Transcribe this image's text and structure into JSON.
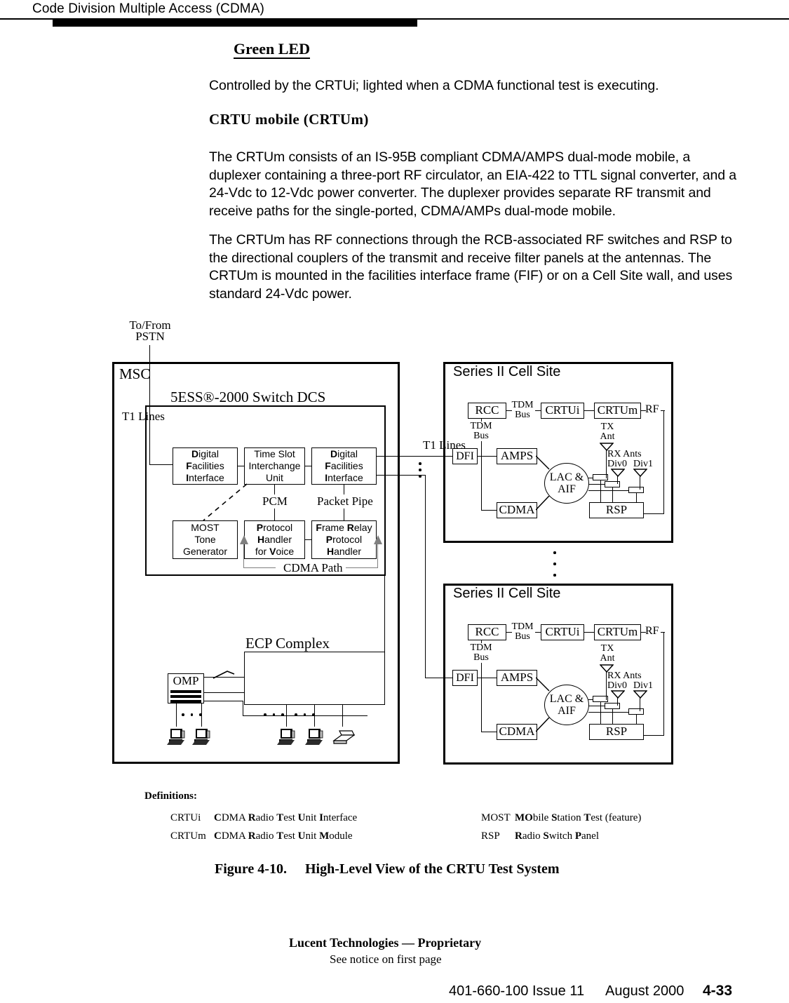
{
  "header": {
    "running_head": "Code Division Multiple Access (CDMA)"
  },
  "body": {
    "green_led_heading": "Green LED",
    "green_led_text": "Controlled by the CRTUi; lighted when a CDMA functional test is executing.",
    "crtum_heading": "CRTU mobile (CRTUm)",
    "paragraph_1": "The CRTUm consists of an IS-95B compliant CDMA/AMPS dual-mode mobile, a duplexer containing a three-port RF circulator, an EIA-422 to TTL signal converter, and a 24-Vdc to 12-Vdc power converter. The duplexer provides separate RF transmit and receive paths for the single-ported, CDMA/AMPs dual-mode mobile.",
    "paragraph_2": "The CRTUm has RF connections through the RCB-associated RF switches and RSP to the directional couplers of the transmit and receive filter panels at the antennas. The CRTUm is mounted in the facilities interface frame (FIF) or on a Cell Site wall, and uses standard 24-Vdc power."
  },
  "figure": {
    "pstn_label": "To/From\nPSTN",
    "pstn_line1": "To/From",
    "pstn_line2": "PSTN",
    "msc_label": "MSC",
    "switch_title": "5ESS®-2000 Switch DCS",
    "t1_lines_left": "T1 Lines",
    "t1_lines_right": "T1 Lines",
    "ecp_label": "ECP Complex",
    "omp_label": "OMP",
    "switch_boxes": {
      "dfi_left": [
        "Digital",
        "Facilities",
        "Interface"
      ],
      "tsiu": [
        "Time Slot",
        "Interchange",
        "Unit"
      ],
      "dfi_right": [
        "Digital",
        "Facilities",
        "Interface"
      ],
      "most": [
        "MOST",
        "Tone",
        "Generator"
      ],
      "phv": [
        "Protocol",
        "Handler",
        "for Voice"
      ],
      "frph": [
        "Frame Relay",
        "Protocol",
        "Handler"
      ]
    },
    "pcm_label": "PCM",
    "packet_pipe_label": "Packet Pipe",
    "cdma_path_label": "CDMA Path",
    "cell_site_title": "Series II Cell Site",
    "cell_blocks": {
      "rcc": "RCC",
      "crtui": "CRTUi",
      "crtum": "CRTUm",
      "dfi": "DFI",
      "amps": "AMPS",
      "cdma": "CDMA",
      "rsp": "RSP",
      "lac_aif_line1": "LAC &",
      "lac_aif_line2": "AIF",
      "tdm_bus_line1": "TDM",
      "tdm_bus_line2": "Bus",
      "rf": "RF",
      "tx_ant_line1": "TX",
      "tx_ant_line2": "Ant",
      "rx_ants": "RX Ants",
      "div0": "Div0",
      "div1": "Div1"
    }
  },
  "definitions": {
    "title": "Definitions:",
    "entries": [
      {
        "abbr": "CRTUi",
        "expansion_html": "<b>C</b>DMA <b>R</b>adio <b>T</b>est <b>U</b>nit <b>I</b>nterface",
        "expansion": "CDMA Radio Test Unit Interface"
      },
      {
        "abbr": "CRTUm",
        "expansion_html": "<b>C</b>DMA <b>R</b>adio <b>T</b>est <b>U</b>nit <b>M</b>odule",
        "expansion": "CDMA Radio Test Unit Module"
      },
      {
        "abbr": "MOST",
        "expansion_html": "<b>MO</b>bile <b>S</b>tation <b>T</b>est (feature)",
        "expansion": "MObile Station Test (feature)"
      },
      {
        "abbr": "RSP",
        "expansion_html": "<b>R</b>adio <b>S</b>witch <b>P</b>anel",
        "expansion": "Radio Switch Panel"
      }
    ]
  },
  "caption": {
    "number": "Figure 4-10.",
    "text": "High-Level View of the CRTU Test System"
  },
  "footer": {
    "proprietary": "Lucent Technologies — Proprietary",
    "notice": "See notice on first page",
    "doc_id": "401-660-100 Issue 11",
    "date": "August 2000",
    "page": "4-33"
  }
}
